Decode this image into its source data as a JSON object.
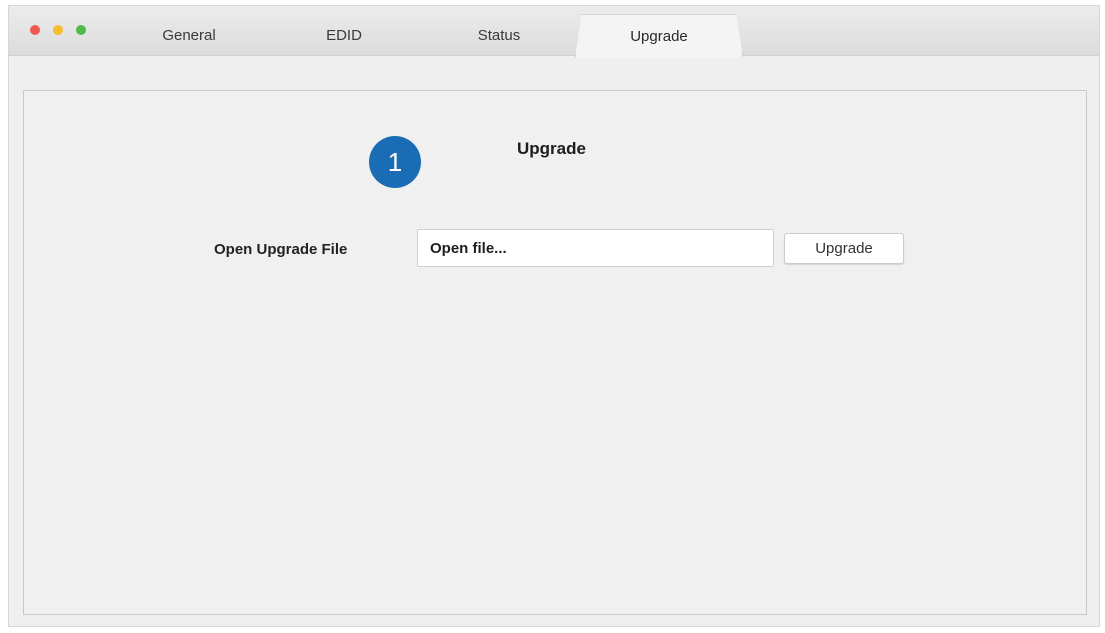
{
  "window": {
    "controls": [
      "close",
      "minimize",
      "zoom"
    ]
  },
  "tabs": [
    {
      "label": "General",
      "active": false
    },
    {
      "label": "EDID",
      "active": false
    },
    {
      "label": "Status",
      "active": false
    },
    {
      "label": "Upgrade",
      "active": true
    }
  ],
  "panel": {
    "step_number": "1",
    "title": "Upgrade",
    "file_row": {
      "label": "Open Upgrade File",
      "input_value": "",
      "input_placeholder": "Open file...",
      "button_label": "Upgrade"
    }
  },
  "colors": {
    "badge": "#1a6db5",
    "close": "#ee5a52",
    "minimize": "#f5be2d",
    "zoom": "#4fba48"
  }
}
